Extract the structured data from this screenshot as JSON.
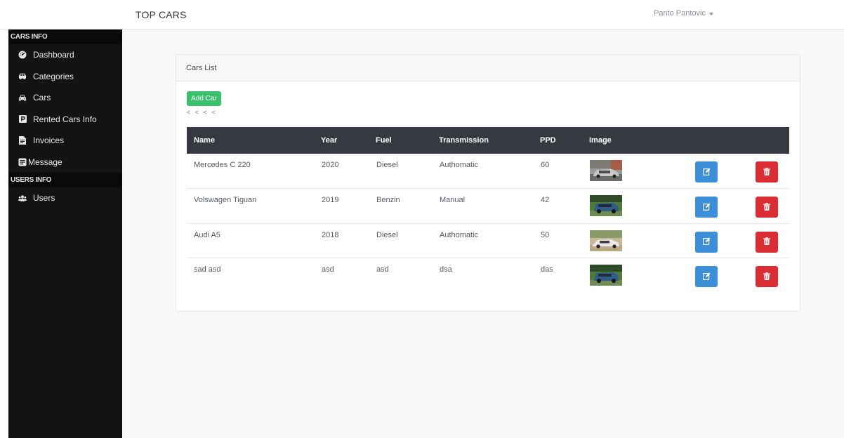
{
  "header": {
    "brand": "TOP CARS",
    "user_name": "Panto Pantovic"
  },
  "sidebar": {
    "sections": [
      {
        "heading": "CARS INFO",
        "items": [
          {
            "label": "Dashboard",
            "icon": "tachometer-icon"
          },
          {
            "label": "Categories",
            "icon": "car-side-icon"
          },
          {
            "label": "Cars",
            "icon": "car-icon"
          },
          {
            "label": "Rented Cars Info",
            "icon": "parking-icon"
          },
          {
            "label": "Invoices",
            "icon": "invoice-icon"
          },
          {
            "label": "Message",
            "icon": "message-icon"
          }
        ]
      },
      {
        "heading": "USERS INFO",
        "items": [
          {
            "label": "Users",
            "icon": "users-icon"
          }
        ]
      }
    ]
  },
  "card": {
    "title": "Cars List",
    "add_button": "Add Car",
    "pager": "< < < <"
  },
  "table": {
    "columns": [
      "Name",
      "Year",
      "Fuel",
      "Transmission",
      "PPD",
      "Image"
    ],
    "rows": [
      {
        "name": "Mercedes C 220",
        "year": "2020",
        "fuel": "Diesel",
        "transmission": "Authomatic",
        "ppd": "60",
        "image_color": "#8a8a8a"
      },
      {
        "name": "Volswagen Tiguan",
        "year": "2019",
        "fuel": "Benzin",
        "transmission": "Manual",
        "ppd": "42",
        "image_color": "#2f5c8a"
      },
      {
        "name": "Audi A5",
        "year": "2018",
        "fuel": "Diesel",
        "transmission": "Authomatic",
        "ppd": "50",
        "image_color": "#d9d9d9"
      },
      {
        "name": "sad asd",
        "year": "asd",
        "fuel": "asd",
        "transmission": "dsa",
        "ppd": "das",
        "image_color": "#2f5c8a"
      }
    ]
  },
  "colors": {
    "sidebar_bg": "#131313",
    "table_header_bg": "#343a40",
    "add_button": "#3ac06a",
    "edit_button": "#3a8fd8",
    "delete_button": "#dc2d34"
  }
}
